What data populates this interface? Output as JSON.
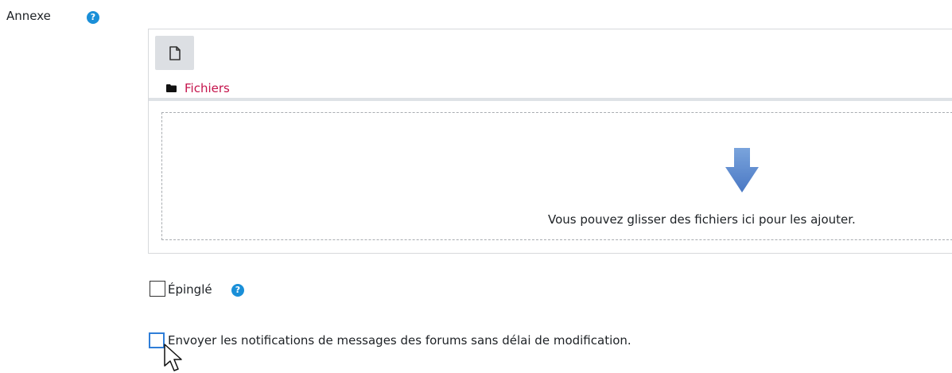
{
  "form": {
    "attachment": {
      "label": "Annexe",
      "help_icon": "question-circle-icon"
    },
    "filemanager": {
      "toolbar": {
        "create_file_icon": "file-icon"
      },
      "path": {
        "icon": "folder-icon",
        "label": "Fichiers"
      },
      "dropzone": {
        "arrow_icon": "down-arrow-icon",
        "text": "Vous pouvez glisser des fichiers ici pour les ajouter."
      }
    },
    "pinned": {
      "label": "Épinglé",
      "checked": false,
      "help_icon": "question-circle-icon"
    },
    "notify": {
      "label": "Envoyer les notifications de messages des forums sans délai de modification.",
      "checked": false
    }
  },
  "colors": {
    "link": "#c5144c",
    "help": "#1a8fd8",
    "focus": "#2f7ed8",
    "toolbar_button": "#dcdfe3"
  }
}
